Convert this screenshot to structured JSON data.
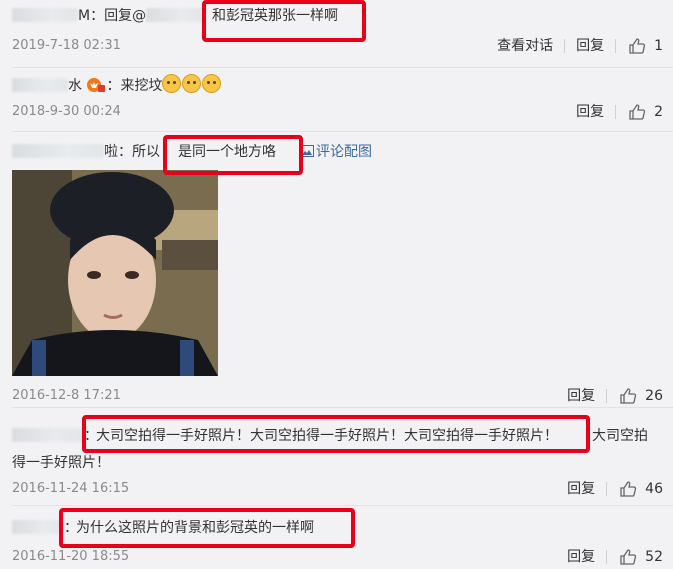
{
  "comments": [
    {
      "prefix": "M：回复@",
      "text": "和彭冠英那张一样啊",
      "time": "2019-7-18 02:31",
      "actions": [
        "查看对话",
        "回复"
      ],
      "likes": "1"
    },
    {
      "prefix": "水",
      "text": "：来挖坟",
      "emoji": [
        "doge-emoji",
        "doge-emoji",
        "doge-emoji"
      ],
      "time": "2018-9-30 00:24",
      "actions": [
        "回复"
      ],
      "likes": "2"
    },
    {
      "prefix": "啦：所以",
      "text": "是同一个地方咯",
      "link": "评论配图",
      "time": "2016-12-8 17:21",
      "actions": [
        "回复"
      ],
      "likes": "26"
    },
    {
      "prefix": "：",
      "text": "大司空拍得一手好照片！大司空拍得一手好照片！大司空拍得一手好照片！",
      "text_tail": "大司空拍",
      "text_line2": "得一手好照片！",
      "time": "2016-11-24 16:15",
      "actions": [
        "回复"
      ],
      "likes": "46"
    },
    {
      "prefix": "：",
      "text": "为什么这照片的背景和彭冠英的一样啊",
      "time": "2016-11-20 18:55",
      "actions": [
        "回复"
      ],
      "likes": "52"
    }
  ],
  "icons": {
    "like": "thumbs-up-icon",
    "vip": "vip-badge-icon",
    "image": "image-icon"
  },
  "colors": {
    "highlight": "#e8001a",
    "link": "#3b6aa4",
    "time": "#8a8a8a"
  }
}
